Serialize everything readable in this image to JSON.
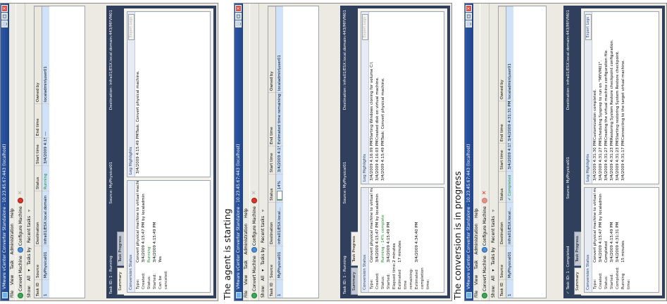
{
  "captions": {
    "p2": "The agent is starting",
    "p3": "The conversion is in progress"
  },
  "window": {
    "title": "VMware vCenter Converter Standalone - 10.23.45.67:443 (localhost)",
    "title_p3": "VMware vCenter Converter Standalone - 10.23.45.67:443 (localhost)",
    "menu": [
      "File",
      "View",
      "Task",
      "Administration",
      "Help"
    ],
    "toolbar": {
      "convert": "Convert Machine",
      "configure": "Configure Machine"
    },
    "filter": {
      "show": "Show:",
      "all": "All",
      "tasks_by": "Tasks by",
      "recent_tasks": "Recent tasks"
    }
  },
  "grid": {
    "columns": [
      "Task ID",
      "Source",
      "Destination",
      "Status",
      "Start time",
      "End time",
      "Owned by"
    ]
  },
  "p1": {
    "row": {
      "id": "1",
      "source": "MyPhysical01",
      "destination": "infra01/ESX.local.domain",
      "status": "Running",
      "start": "3/4/2009 4:15:4...",
      "end": "---",
      "owner": "localadmin\\user01"
    },
    "detail": {
      "task": "Task ID: 1 - Running",
      "source": "Source: MyPhysical01",
      "destination": "Destination: infra01/ESX.local.domain:443/MYVM01"
    },
    "tabs": [
      "Summary",
      "Task Progress"
    ],
    "status_title": "Conversion Status",
    "status": [
      {
        "k": "Type:",
        "v": "Convert physical machine to virtual machine"
      },
      {
        "k": "Created:",
        "v": "3/4/2009 4:15:47 PM by localadmin"
      },
      {
        "k": "Status:",
        "v": "Running"
      },
      {
        "k": "Started:",
        "v": "3/4/2009 4:15:49 PM"
      },
      {
        "k": "Can be canceled:",
        "v": "Yes"
      }
    ],
    "log_title": "Log Highlights",
    "export": "Export Logs",
    "log": [
      {
        "t": "3/4/2009 4:15:49 PM",
        "m": "Task: Convert physical machine."
      }
    ]
  },
  "p2": {
    "row": {
      "id": "1",
      "source": "MyPhysical01",
      "destination": "infra01/ESX.local...",
      "progress": 0.12,
      "status": "14%",
      "start": "3/4/2009 4:15:4...",
      "end": "Estimated time remaining: 17 minutes",
      "owner": "localadmin\\user01"
    },
    "detail": {
      "task": "Task ID: 1 - Running",
      "source": "Source: MyPhysical01",
      "destination": "Destination: infra01/ESX.local.domain:443/MYVM01"
    },
    "tabs": [
      "Summary",
      "Task Progress"
    ],
    "status_title": "Conversion Status",
    "status": [
      {
        "k": "Type:",
        "v": "Convert physical machine to virtual machine"
      },
      {
        "k": "Created:",
        "v": "3/4/2009 4:15:47 PM by localadmin"
      },
      {
        "k": "Status:",
        "v": "Running - 14% complete"
      },
      {
        "k": "Started:",
        "v": "3/4/2009 4:15:49 PM"
      },
      {
        "k": "Elapsed time:",
        "v": "2 minutes"
      },
      {
        "k": "Estimated time remaining:",
        "v": "17 minutes"
      },
      {
        "k": "Estimated completion time:",
        "v": "3/4/2009 4:34:40 PM"
      }
    ],
    "log_title": "Log Highlights",
    "export": "Export Logs",
    "log": [
      {
        "t": "3/4/2009 4:16:09 PM",
        "m": "Starting Windows cloning for volume C:\\"
      },
      {
        "t": "3/4/2009 4:16:03 PM",
        "m": "Created disk on virtual machine."
      },
      {
        "t": "3/4/2009 4:15:49 PM",
        "m": "Task: Convert physical machine."
      }
    ]
  },
  "p3": {
    "row": {
      "id": "1",
      "source": "MyPhysical01",
      "destination": "infra01/ESX.local...",
      "status": "Completed",
      "start": "3/4/2009 4:15:4...",
      "end": "3/4/2009 4:31:31 PM",
      "owner": "localadmin\\user01"
    },
    "detail": {
      "task": "Task ID: 1 - Completed",
      "source": "Source: MyPhysical01",
      "destination": "Destination: infra01/ESX.local.domain:443/MYVM01"
    },
    "tabs": [
      "Summary",
      "Task Progress"
    ],
    "status_title": "Conversion Status",
    "status": [
      {
        "k": "Type:",
        "v": "Convert physical machine to virtual machine"
      },
      {
        "k": "Created:",
        "v": "3/4/2009 4:15:47 PM by localadmin"
      },
      {
        "k": "Status:",
        "v": "Completed"
      },
      {
        "k": "Started:",
        "v": "3/4/2009 4:15:49 PM"
      },
      {
        "k": "Completed:",
        "v": "3/4/2009 4:31:31 PM"
      },
      {
        "k": "Running time:",
        "v": "15 minutes"
      }
    ],
    "log_title": "Log Highlights",
    "export": "Export Logs",
    "log": [
      {
        "t": "3/4/2009 4:31:30 PM",
        "m": "Customization completed."
      },
      {
        "t": "3/4/2009 4:31:27 PM",
        "m": "Scheduling Sysprep to run on \"MYVM01\"."
      },
      {
        "t": "3/4/2009 4:31:27 PM",
        "m": "Creating the virtual machine configuration file."
      },
      {
        "t": "3/4/2009 4:31:23 PM",
        "m": "Restoring System Restore checkpoint configuration."
      },
      {
        "t": "3/4/2009 4:31:23 PM",
        "m": "Starting restoring System Restore checkpoint."
      },
      {
        "t": "3/4/2009 4:31:17 PM",
        "m": "Connecting to the target virtual machine."
      }
    ]
  },
  "colors": {
    "running": "#1e8a2d",
    "title_bar": "#2c58a8",
    "detail_bg": "#2f3f5c"
  }
}
